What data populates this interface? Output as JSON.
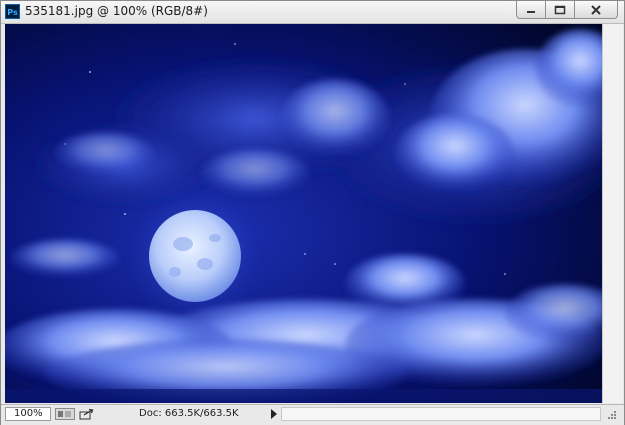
{
  "window": {
    "title": "535181.jpg @ 100% (RGB/8#)",
    "app_icon_text": "Ps",
    "buttons": {
      "minimize": "minimize-icon",
      "maximize": "maximize-icon",
      "close": "close-icon"
    }
  },
  "status": {
    "zoom": "100%",
    "doc_info": "Doc: 663.5K/663.5K"
  },
  "image": {
    "description_icon": "night-sky-moon-photo",
    "colors": {
      "sky": "#020a4a",
      "cloud": "#6f8df5",
      "moon": "#cfe0ff"
    }
  }
}
